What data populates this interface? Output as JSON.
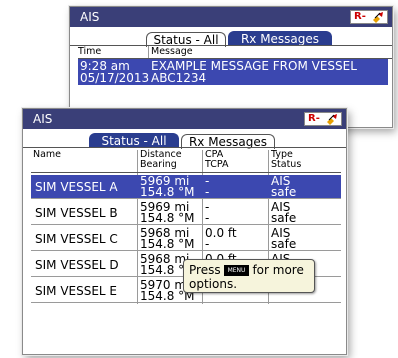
{
  "back_window": {
    "title": "AIS",
    "indicator_label": "R-",
    "tabs": [
      "Status - All",
      "Rx Messages"
    ],
    "active_tab": "Rx Messages",
    "columns": [
      "Time",
      "Message"
    ],
    "messages": [
      {
        "time_line1": "9:28 am",
        "time_line2": "05/17/2013",
        "message_line1": "EXAMPLE MESSAGE FROM VESSEL",
        "message_line2": "ABC1234",
        "selected": true
      }
    ]
  },
  "front_window": {
    "title": "AIS",
    "indicator_label": "R-",
    "tabs": [
      "Status - All",
      "Rx Messages"
    ],
    "active_tab": "Status - All",
    "columns": {
      "name": "Name",
      "distance": "Distance",
      "bearing": "Bearing",
      "cpa": "CPA",
      "tcpa": "TCPA",
      "type": "Type",
      "status": "Status"
    },
    "vessels": [
      {
        "name": "SIM VESSEL A",
        "distance": "5969 mi",
        "bearing": "154.8 °M",
        "cpa": "-",
        "tcpa": "-",
        "type": "AIS",
        "status": "safe",
        "selected": true
      },
      {
        "name": "SIM VESSEL B",
        "distance": "5969 mi",
        "bearing": "154.8 °M",
        "cpa": "-",
        "tcpa": "-",
        "type": "AIS",
        "status": "safe",
        "selected": false
      },
      {
        "name": "SIM VESSEL C",
        "distance": "5968 mi",
        "bearing": "154.8 °M",
        "cpa": "0.0 ft",
        "tcpa": "-",
        "type": "AIS",
        "status": "safe",
        "selected": false
      },
      {
        "name": "SIM VESSEL D",
        "distance": "5968 mi",
        "bearing": "154.8 °M",
        "cpa": "0.0 ft",
        "tcpa": "",
        "type": "AIS",
        "status": "",
        "selected": false
      },
      {
        "name": "SIM VESSEL E",
        "distance": "5970 mi",
        "bearing": "154.8 °M",
        "cpa": "",
        "tcpa": "-",
        "type": "",
        "status": "safe",
        "selected": false
      }
    ],
    "popup": {
      "text_before": "Press",
      "key_label": "MENU",
      "text_after": "for more",
      "text_line2": "options."
    }
  },
  "colors": {
    "titlebar": "#3a3f78",
    "selected_row": "#3c48b0",
    "active_tab": "#2a3d8f",
    "indicator_red": "#cc0000",
    "popup_bg": "#f6f4dc"
  },
  "icons": {
    "indicator": "satellite-icon"
  }
}
